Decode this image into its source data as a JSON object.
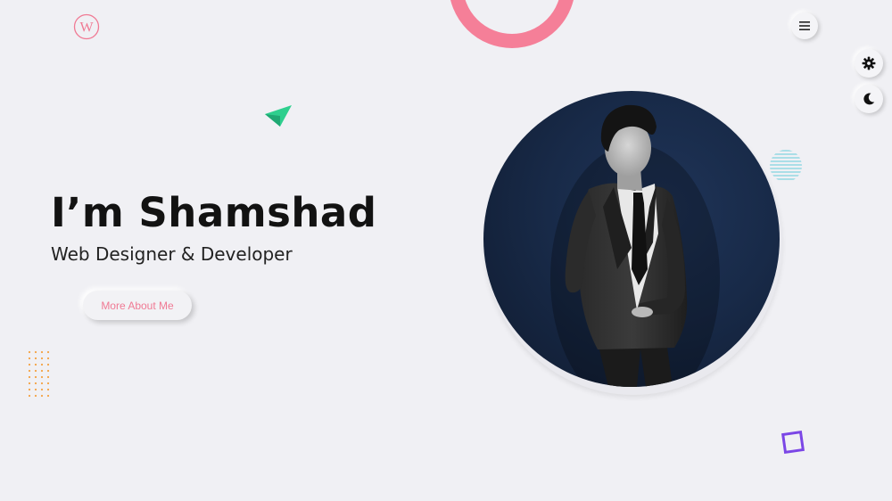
{
  "header": {
    "logo_letter": "W",
    "menu_icon": "hamburger-menu-icon"
  },
  "side_controls": {
    "settings_icon": "gear-icon",
    "theme_icon": "moon-icon"
  },
  "hero": {
    "title": "I’m Shamshad",
    "subtitle": "Web Designer & Developer",
    "cta_label": "More About Me"
  },
  "portrait": {
    "description_icon": "portrait-photo"
  },
  "colors": {
    "background": "#f0f0f4",
    "accent_pink": "#f07a94",
    "ring_pink": "#f57f98",
    "triangle_green": "#2ecf8e",
    "dots_orange": "#f5a243",
    "stripes_cyan": "#7fd3df",
    "square_purple": "#7b46e6",
    "portrait_bg": "#182a48"
  }
}
